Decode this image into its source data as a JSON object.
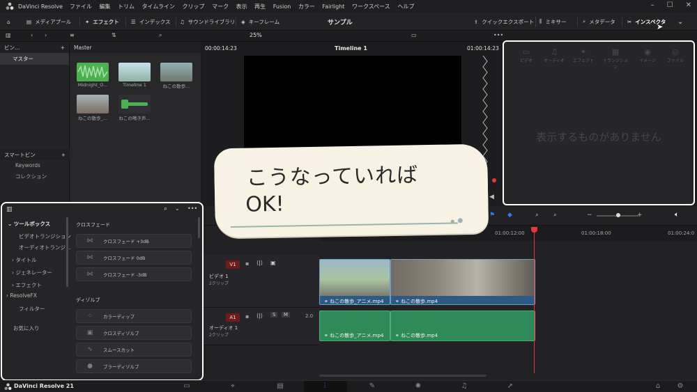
{
  "titlebar": {
    "app_name": "DaVinci Resolve",
    "menus": [
      "ファイル",
      "編集",
      "トリム",
      "タイムライン",
      "クリップ",
      "マーク",
      "表示",
      "再生",
      "Fusion",
      "カラー",
      "Fairlight",
      "ワークスペース",
      "ヘルプ"
    ]
  },
  "toolbar": {
    "media_pool": "メディアプール",
    "effects": "エフェクト",
    "index": "インデックス",
    "sound_library": "サウンドライブラリ",
    "keyframes": "キーフレーム",
    "project_title": "サンプル",
    "quick_export": "クイックエクスポート",
    "mixer": "ミキサー",
    "metadata": "メタデータ",
    "inspector": "インスペクタ"
  },
  "subbar": {
    "zoom": "25%",
    "timecode_left": "00:00:14:23",
    "timeline_name": "Timeline 1",
    "timecode_right": "01:00:14:23"
  },
  "bins": {
    "header": "ビン…",
    "master": "マスター",
    "smart_bins": "スマートビン",
    "keywords": "Keywords",
    "collections": "コレクション"
  },
  "media_pool": {
    "header": "Master",
    "clips": [
      {
        "label": "Midnight_O..."
      },
      {
        "label": "Timeline 1"
      },
      {
        "label": "ねこの散歩..."
      },
      {
        "label": "ねこの散歩_..."
      },
      {
        "label": "ねこの鳴き声..."
      }
    ]
  },
  "inspector": {
    "tabs": [
      "ビデオ",
      "オーディオ",
      "エフェクト",
      "トランジション",
      "イメージ",
      "ファイル"
    ],
    "empty_message": "表示するものがありません"
  },
  "toolbox": {
    "tree": {
      "root": "ツールボックス",
      "video_transitions": "ビデオトランジション",
      "audio_transitions": "オーディオトランジ…",
      "titles": "タイトル",
      "generators": "ジェネレーター",
      "effects": "エフェクト",
      "resolvefx": "ResolveFX",
      "filters": "フィルター",
      "favorites": "お気に入り"
    },
    "crossfade_header": "クロスフェード",
    "crossfades": [
      "クロスフェード +3dB",
      "クロスフェード 0dB",
      "クロスフェード -3dB"
    ],
    "dissolve_header": "ディゾルブ",
    "dissolves": [
      "カラーディップ",
      "クロスディゾルブ",
      "スムースカット",
      "ブラーディゾルブ"
    ]
  },
  "timeline": {
    "ruler": [
      "01:00:12:00",
      "01:00:18:00",
      "01:00:24:0"
    ],
    "video_track": {
      "badge": "V1",
      "name": "ビデオ 1",
      "clips_count": "2クリップ"
    },
    "audio_track": {
      "badge": "A1",
      "name": "オーディオ 1",
      "clips_count": "2クリップ",
      "level": "2.0"
    },
    "video_clips": [
      "ねこの散歩_アニメ.mp4",
      "ねこの散歩.mp4"
    ],
    "audio_clips": [
      "ねこの散歩_アニメ.mp4",
      "ねこの散歩.mp4"
    ]
  },
  "pagebar": {
    "brand": "DaVinci Resolve 21"
  },
  "callout": {
    "line1": "こうなっていれば",
    "line2": "OK!"
  },
  "colors": {
    "video_clip": "#2d5a85",
    "audio_clip": "#2f8a59",
    "playhead": "#e03b3b",
    "accent_blue": "#2f7de1"
  }
}
